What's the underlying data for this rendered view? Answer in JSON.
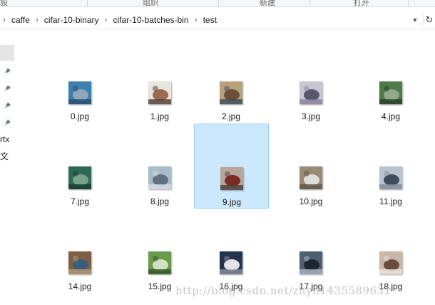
{
  "ribbon": {
    "groups": [
      "設",
      "组织",
      "新建",
      "打开"
    ]
  },
  "breadcrumbs": [
    "caffe",
    "cifar-10-binary",
    "cifar-10-batches-bin",
    "test"
  ],
  "nav_fragments": [
    "rtx",
    "文"
  ],
  "files": [
    {
      "name": "0.jpg",
      "colors": [
        "#3f7fb0",
        "#8ea7bb",
        "#2b4f6b"
      ]
    },
    {
      "name": "1.jpg",
      "colors": [
        "#e8e4de",
        "#9a6b4e",
        "#4d3a2e"
      ]
    },
    {
      "name": "2.jpg",
      "colors": [
        "#b8a27c",
        "#6b5037",
        "#3a4b5d"
      ]
    },
    {
      "name": "3.jpg",
      "colors": [
        "#c9c6d4",
        "#5b5670",
        "#8a7e9e"
      ]
    },
    {
      "name": "4.jpg",
      "colors": [
        "#4e7a46",
        "#91a88b",
        "#2c3f2a"
      ]
    },
    {
      "name": "7.jpg",
      "colors": [
        "#2f6a57",
        "#78a28e",
        "#1c3a31"
      ]
    },
    {
      "name": "8.jpg",
      "colors": [
        "#a8bcc9",
        "#60707c",
        "#d4dde3"
      ]
    },
    {
      "name": "9.jpg",
      "colors": [
        "#b8a69a",
        "#7a2c25",
        "#4c3d36"
      ]
    },
    {
      "name": "10.jpg",
      "colors": [
        "#9a8b78",
        "#e0ddd6",
        "#5e5446"
      ]
    },
    {
      "name": "11.jpg",
      "colors": [
        "#b9c3ce",
        "#3e4d5c",
        "#808c98"
      ]
    },
    {
      "name": "14.jpg",
      "colors": [
        "#7e5e44",
        "#3c5d7c",
        "#b49c7c"
      ]
    },
    {
      "name": "15.jpg",
      "colors": [
        "#6a9a4c",
        "#cfe0c4",
        "#35552a"
      ]
    },
    {
      "name": "16.jpg",
      "colors": [
        "#24344f",
        "#e4e4e8",
        "#8a8f9a"
      ]
    },
    {
      "name": "17.jpg",
      "colors": [
        "#4f5f70",
        "#1c2530",
        "#a9b5c2"
      ]
    },
    {
      "name": "18.jpg",
      "colors": [
        "#c9b7a7",
        "#6a4e3d",
        "#eee4dc"
      ]
    }
  ],
  "selected_file": "9.jpg",
  "watermark": "http://blog.csdn.net/zhyh1435589631",
  "icons": {
    "pin": "pin-icon",
    "refresh": "refresh-icon",
    "dropdown": "chevron-down-icon"
  }
}
